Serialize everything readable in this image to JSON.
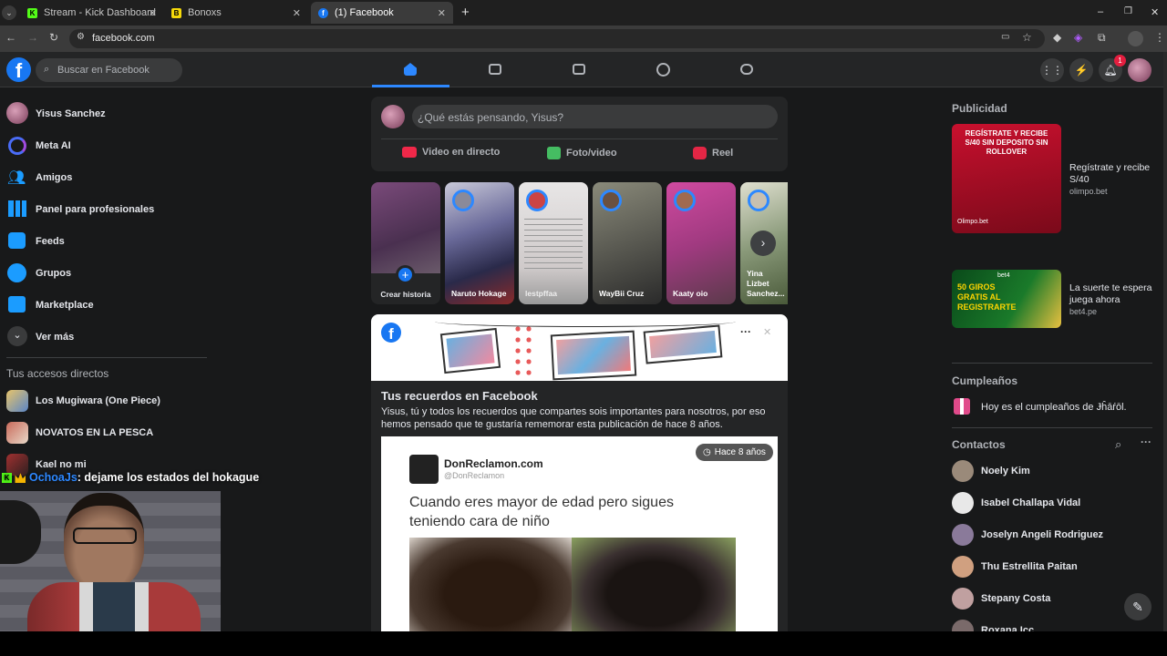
{
  "browser": {
    "tabs": [
      {
        "label": "Stream - Kick Dashboard",
        "favicon": "K",
        "color": "#53fc18"
      },
      {
        "label": "Bonoxs",
        "favicon": "B",
        "color": "#f5d90a"
      },
      {
        "label": "(1) Facebook",
        "favicon": "f",
        "color": "#1877f2"
      }
    ],
    "new_tab": "+",
    "url": "facebook.com",
    "window_controls": [
      "–",
      "❐",
      "✕"
    ]
  },
  "facebook": {
    "search_placeholder": "Buscar en Facebook",
    "notification_count": "1",
    "sidebar": {
      "items": [
        {
          "label": "Yisus Sanchez",
          "icon": "profile-avatar"
        },
        {
          "label": "Meta AI",
          "icon": "meta-ai-icon"
        },
        {
          "label": "Amigos",
          "icon": "friends-icon"
        },
        {
          "label": "Panel para profesionales",
          "icon": "dashboard-icon"
        },
        {
          "label": "Feeds",
          "icon": "feeds-icon"
        },
        {
          "label": "Grupos",
          "icon": "groups-icon"
        },
        {
          "label": "Marketplace",
          "icon": "marketplace-icon"
        },
        {
          "label": "Ver más",
          "icon": "chevron-down-icon"
        }
      ],
      "shortcuts_title": "Tus accesos directos",
      "shortcuts": [
        {
          "label": "Los Mugiwara (One Piece)"
        },
        {
          "label": "NOVATOS EN LA PESCA"
        },
        {
          "label": "Kael no mi"
        }
      ]
    },
    "composer": {
      "placeholder": "¿Qué estás pensando, Yisus?",
      "actions": [
        {
          "label": "Video en directo",
          "color": "#f02849"
        },
        {
          "label": "Foto/video",
          "color": "#45bd62"
        },
        {
          "label": "Reel",
          "color": "#e42645"
        }
      ]
    },
    "stories": [
      {
        "label": "Crear historia"
      },
      {
        "label": "Naruto Hokage"
      },
      {
        "label": "lestpffaa"
      },
      {
        "label": "WayBii Cruz"
      },
      {
        "label": "Kaaty oio"
      },
      {
        "label": "Yina Lizbet Sanchez..."
      }
    ],
    "memories": {
      "title": "Tus recuerdos en Facebook",
      "text": "Yisus, tú y todos los recuerdos que compartes sois importantes para nosotros, por eso hemos pensado que te gustaría rememorar esta publicación de hace 8 años.",
      "badge": "Hace 8 años",
      "post_author": "DonReclamon.com",
      "post_handle": "@DonReclamon",
      "post_text": "Cuando eres mayor de edad pero sigues teniendo cara de niño",
      "more": "···",
      "close": "✕"
    },
    "right": {
      "ads_title": "Publicidad",
      "ads": [
        {
          "title": "Regístrate y recibe S/40",
          "domain": "olimpo.bet",
          "image_text": "REGÍSTRATE Y RECIBE S/40 SIN DEPOSITO SIN ROLLOVER",
          "brand": "Olimpo.bet"
        },
        {
          "title": "La suerte te espera juega ahora",
          "domain": "bet4.pe",
          "image_text": "50 GIROS GRATIS AL REGISTRARTE",
          "brand": "bet4"
        }
      ],
      "birthdays_title": "Cumpleaños",
      "birthday_text": "Hoy es el cumpleaños de Ɉĥāŕōl.",
      "contacts_title": "Contactos",
      "contacts": [
        {
          "name": "Noely Kim"
        },
        {
          "name": "Isabel Challapa Vidal"
        },
        {
          "name": "Joselyn Angeli Rodriguez"
        },
        {
          "name": "Thu Estrellita Paitan"
        },
        {
          "name": "Stepany Costa"
        },
        {
          "name": "Roxana Icc"
        }
      ]
    }
  },
  "stream_overlay": {
    "chat_user": "OchoaJs",
    "chat_message": ": dejame los estados del hokague"
  }
}
